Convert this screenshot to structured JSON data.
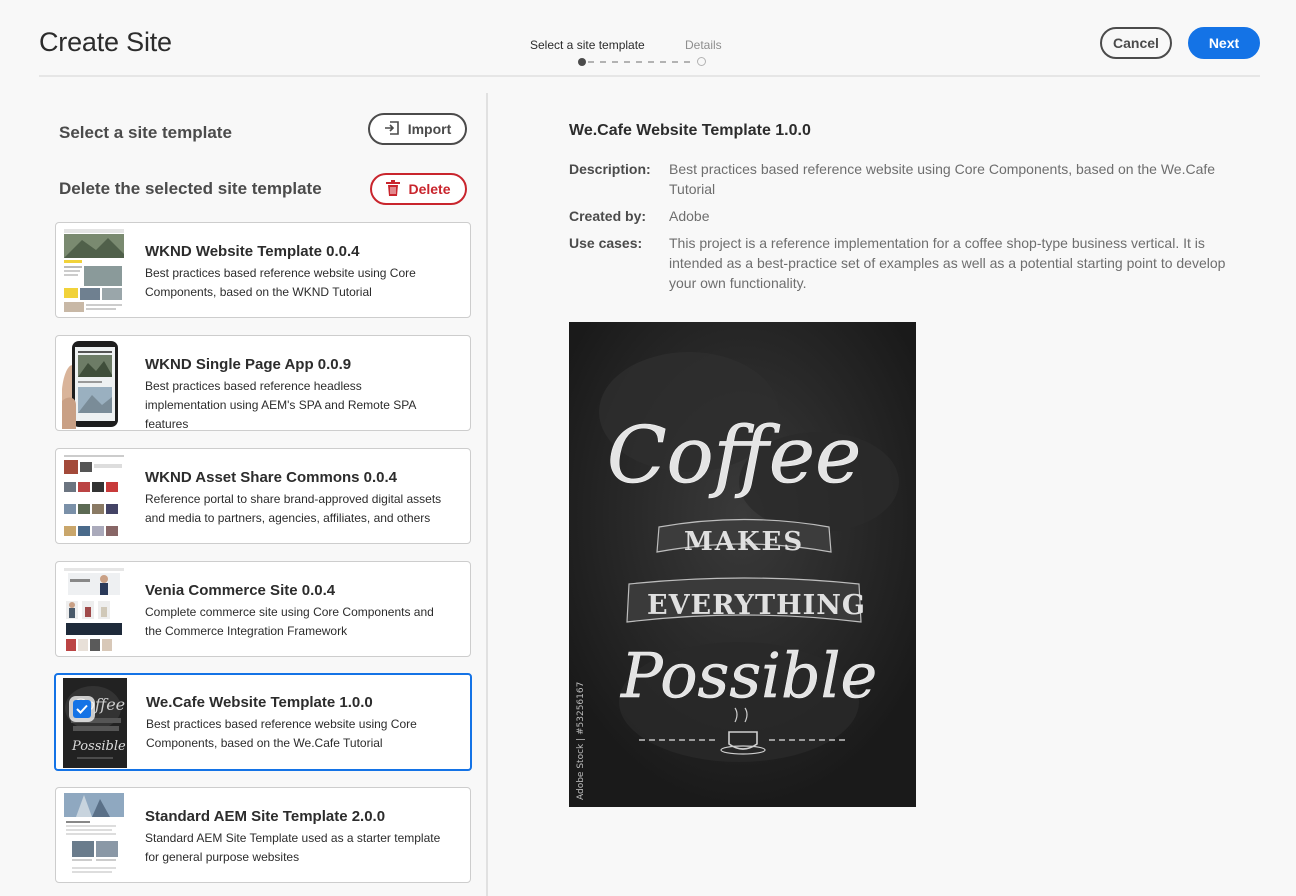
{
  "header": {
    "title": "Create Site",
    "steps": [
      "Select a site template",
      "Details"
    ],
    "cancel_label": "Cancel",
    "next_label": "Next",
    "accent_color": "#1473e6"
  },
  "left": {
    "select_label": "Select a site template",
    "delete_label_text": "Delete the selected site template",
    "import_label": "Import",
    "delete_label": "Delete",
    "templates": [
      {
        "title": "WKND Website Template 0.0.4",
        "desc": "Best practices based reference website using Core Components, based on the WKND Tutorial"
      },
      {
        "title": "WKND Single Page App 0.0.9",
        "desc": "Best practices based reference headless implementation using AEM's SPA and Remote SPA features"
      },
      {
        "title": "WKND Asset Share Commons 0.0.4",
        "desc": "Reference portal to share brand-approved digital assets and media to partners, agencies, affiliates, and others"
      },
      {
        "title": "Venia Commerce Site 0.0.4",
        "desc": "Complete commerce site using Core Components and the Commerce Integration Framework"
      },
      {
        "title": "We.Cafe Website Template 1.0.0",
        "desc": "Best practices based reference website using Core Components, based on the We.Cafe Tutorial"
      },
      {
        "title": "Standard AEM Site Template 2.0.0",
        "desc": "Standard AEM Site Template used as a starter template for general purpose websites"
      }
    ],
    "selected_index": 4
  },
  "detail": {
    "title": "We.Cafe Website Template 1.0.0",
    "description_key": "Description:",
    "description": "Best practices based reference website using Core Components, based on the We.Cafe Tutorial",
    "created_key": "Created by:",
    "created": "Adobe",
    "usecases_key": "Use cases:",
    "usecases": "This project is a reference implementation for a coffee shop-type business vertical. It is intended as a best-practice set of examples as well as a potential starting point to develop your own functionality."
  },
  "preview": {
    "line1": "Coffee",
    "line2": "MAKES",
    "line3": "EVERYTHING",
    "line4": "Possible",
    "watermark": "Adobe Stock | #53256167"
  }
}
